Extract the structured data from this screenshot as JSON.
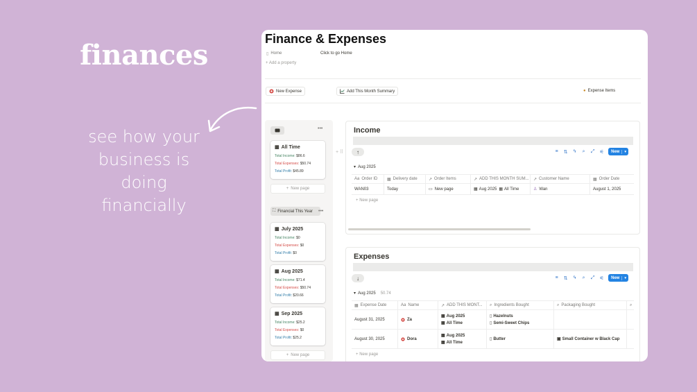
{
  "promo": {
    "title": "finances",
    "subtitle_lines": [
      "see how your",
      "business is",
      "doing",
      "financially"
    ]
  },
  "page": {
    "title": "Finance & Expenses",
    "property_name": "Home",
    "property_value": "Click to go Home",
    "add_property": "Add a property"
  },
  "actions": {
    "new_expense": "New Expense",
    "add_summary": "Add This Month Summary",
    "expense_items": "Expense Items"
  },
  "sidebar": {
    "cards_top": [
      {
        "title": "All Time",
        "income_label": "Total Income:",
        "income": "$86.6",
        "expenses_label": "Total Expenses:",
        "expenses": "$50.74",
        "profit_label": "Total Profit:",
        "profit": "$45.89"
      }
    ],
    "new_page": "New page",
    "group_label": "Financial This Year",
    "cards_year": [
      {
        "title": "July 2025",
        "income_label": "Total Income:",
        "income": "$0",
        "expenses_label": "Total Expenses:",
        "expenses": "$0",
        "profit_label": "Total Profit:",
        "profit": "$0"
      },
      {
        "title": "Aug 2025",
        "income_label": "Total Income:",
        "income": "$71.4",
        "expenses_label": "Total Expenses:",
        "expenses": "$50.74",
        "profit_label": "Total Profit:",
        "profit": "$20.66"
      },
      {
        "title": "Sep 2025",
        "income_label": "Total Income:",
        "income": "$25.2",
        "expenses_label": "Total Expenses:",
        "expenses": "$0",
        "profit_label": "Total Profit:",
        "profit": "$25.2"
      }
    ],
    "new_page_2": "New page"
  },
  "income": {
    "title": "Income",
    "new_label": "New",
    "group": "Aug 2025",
    "columns": [
      "Order ID",
      "Delivery date",
      "Order Items",
      "ADD THIS MONTH SUM...",
      "Customer Name",
      "Order Date"
    ],
    "row": {
      "order_id": "WAN03",
      "delivery": "Today",
      "items": "New page",
      "month": "Aug 2025",
      "alltime": "All Time",
      "customer": "Wan",
      "order_date": "August 1, 2025"
    },
    "add_row": "New page"
  },
  "expenses": {
    "title": "Expenses",
    "new_label": "New",
    "group": "Aug 2025",
    "group_sum": "50.74",
    "columns": [
      "Expense Date",
      "Name",
      "ADD THIS MONT...",
      "Ingredients Bought",
      "Packaging Bought"
    ],
    "rows": [
      {
        "date": "August 31, 2025",
        "name": "Za",
        "month": "Aug 2025",
        "alltime": "All Time",
        "ingredient1": "Hazelnuts",
        "ingredient2": "Semi-Sweet Chips",
        "packaging": ""
      },
      {
        "date": "August 30, 2025",
        "name": "Dora",
        "month": "Aug 2025",
        "alltime": "All Time",
        "ingredient1": "Butter",
        "ingredient2": "",
        "packaging": "Small Container w Black Cap"
      }
    ],
    "add_row": "New page"
  },
  "colors": {
    "background": "#d0b3d6",
    "accent": "#2383e2",
    "income_green": "#448361",
    "expense_red": "#d44c47",
    "profit_blue": "#337ea9"
  }
}
